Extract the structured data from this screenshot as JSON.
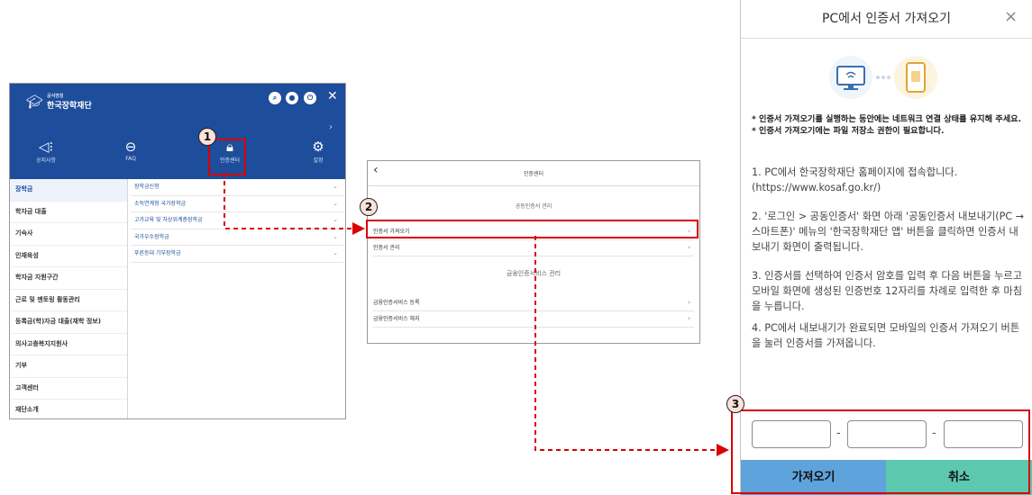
{
  "screen1": {
    "logo_small": "공식명칭",
    "logo_name": "한국장학재단",
    "nav": [
      {
        "icon": "megaphone-icon",
        "glyph": "◁⁝",
        "label": "공지사항"
      },
      {
        "icon": "faq-icon",
        "glyph": "⊖",
        "label": "FAQ"
      },
      {
        "icon": "lock-icon",
        "glyph": "🔒︎",
        "label": "인증센터"
      },
      {
        "icon": "gear-icon",
        "glyph": "⚙",
        "label": "설정"
      }
    ],
    "categories": [
      "장학금",
      "학자금 대출",
      "기숙사",
      "인재육성",
      "학자금 지원구간",
      "근로 및 멘토링 활동관리",
      "등록금(학)자금 대출(재학 정보)",
      "의사고충복지지원사",
      "기부",
      "고객센터",
      "재단소개"
    ],
    "subitems": [
      "장학금신청",
      "소득연계형 국가장학금",
      "고가교육 및 차상위계층장학금",
      "국가우수장학금",
      "푸른등대 기부장학금"
    ]
  },
  "screen2": {
    "back": "‹",
    "title": "인증센터",
    "section1": "공동인증서 관리",
    "section1_items": [
      "인증서 가져오기",
      "인증서 관리"
    ],
    "section2": "금융인증서비스 관리",
    "section2_items": [
      "금융인증서비스 등록",
      "금융인증서비스 해지"
    ]
  },
  "screen3": {
    "title": "PC에서 인증서 가져오기",
    "close": "×",
    "note": "* 인증서 가져오기를 실행하는 동안에는 네트워크 연결 상태를 유지해 주세요.\n* 인증서 가져오기에는 파일 저장소 권한이 필요합니다.",
    "steps": [
      "1. PC에서 한국장학재단 홈페이지에 접속합니다. (https://www.kosaf.go.kr/)",
      "2. '로그인 > 공동인증서' 화면 아래 '공동인증서 내보내기(PC → 스마트폰)' 메뉴의 '한국장학재단 앱' 버튼을 클릭하면 인증서 내보내기 화면이 출력됩니다.",
      "3. 인증서를 선택하여 인증서 암호를 입력 후 다음 버튼을 누르고 모바일 화면에 생성된 인증번호 12자리를 차례로 입력한 후 마침을 누릅니다.",
      "4. PC에서 내보내기가 완료되면 모바일의 인증서 가져오기 버튼을 눌러 인증서를 가져옵니다."
    ],
    "code_sep": "-",
    "import_label": "가져오기",
    "cancel_label": "취소"
  },
  "callouts": [
    "1",
    "2",
    "3"
  ],
  "colors": {
    "brand_blue": "#1d4d9b",
    "import_btn": "#5ea3dc",
    "cancel_btn": "#5cc8ae",
    "highlight_red": "#d90000"
  }
}
